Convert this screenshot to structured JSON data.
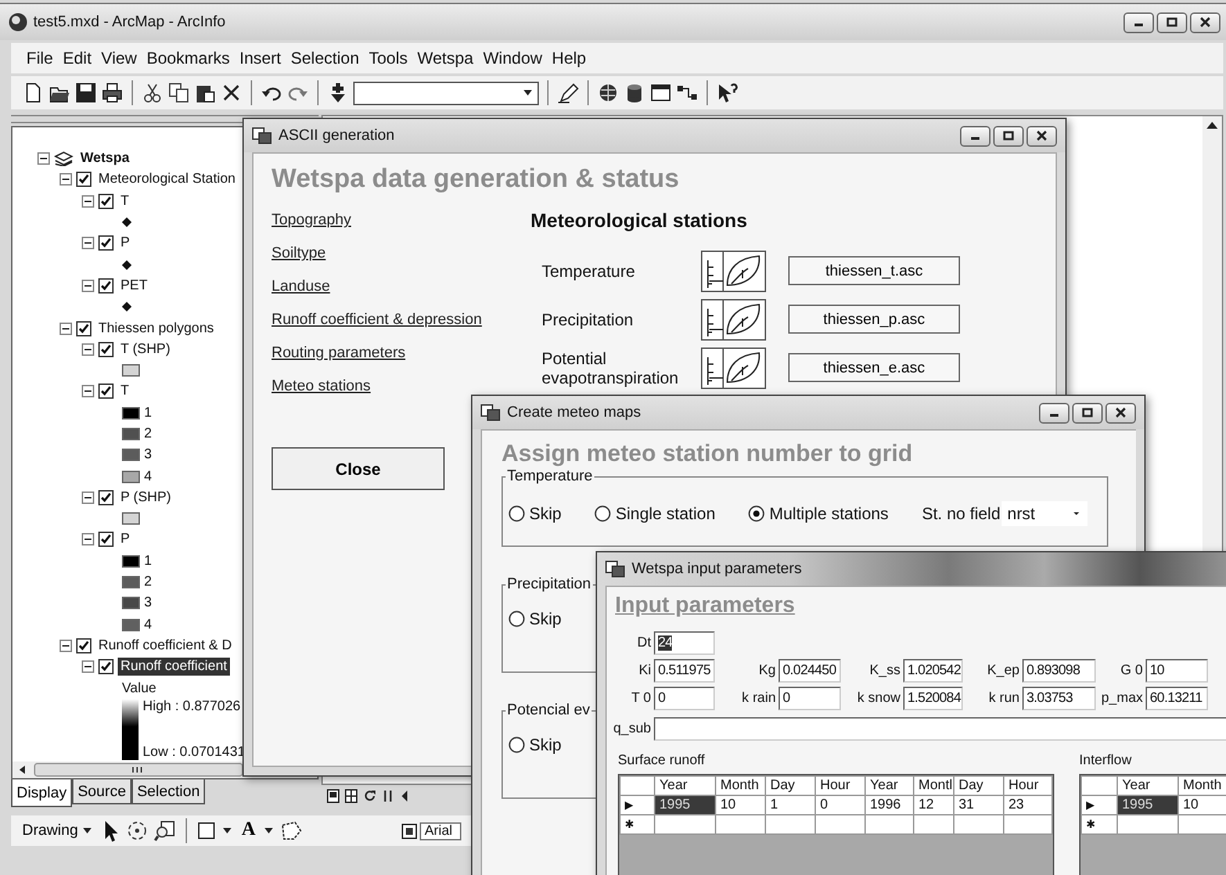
{
  "main_window": {
    "title": "test5.mxd - ArcMap - ArcInfo"
  },
  "menu": [
    "File",
    "Edit",
    "View",
    "Bookmarks",
    "Insert",
    "Selection",
    "Tools",
    "Wetspa",
    "Window",
    "Help"
  ],
  "toc": {
    "tree": [
      {
        "label": "Wetspa",
        "kind": "group",
        "expanded": true,
        "selected": false,
        "children": [
          {
            "label": "Meteorological Station",
            "kind": "layer",
            "checked": true,
            "expanded": true,
            "selected": false,
            "children": [
              {
                "label": "T",
                "kind": "layer",
                "checked": true,
                "expanded": true,
                "selected": false,
                "legend": [
                  {
                    "kind": "marker"
                  }
                ]
              },
              {
                "label": "P",
                "kind": "layer",
                "checked": true,
                "expanded": true,
                "selected": false,
                "legend": [
                  {
                    "kind": "marker"
                  }
                ]
              },
              {
                "label": "PET",
                "kind": "layer",
                "checked": true,
                "expanded": true,
                "selected": false,
                "legend": [
                  {
                    "kind": "marker"
                  }
                ]
              }
            ]
          },
          {
            "label": "Thiessen polygons",
            "kind": "layer",
            "checked": true,
            "expanded": true,
            "selected": false,
            "children": [
              {
                "label": "T (SHP)",
                "kind": "layer",
                "checked": true,
                "expanded": true,
                "selected": false,
                "legend": [
                  {
                    "kind": "swatch",
                    "color": "#d4d4d4"
                  }
                ]
              },
              {
                "label": "T",
                "kind": "layer",
                "checked": true,
                "expanded": true,
                "selected": false,
                "legend": [
                  {
                    "kind": "swatch",
                    "color": "#000000",
                    "label": "1"
                  },
                  {
                    "kind": "swatch",
                    "color": "#505050",
                    "label": "2"
                  },
                  {
                    "kind": "swatch",
                    "color": "#5c5c5c",
                    "label": "3"
                  },
                  {
                    "kind": "swatch",
                    "color": "#a8a8a8",
                    "label": "4"
                  }
                ]
              },
              {
                "label": "P (SHP)",
                "kind": "layer",
                "checked": true,
                "expanded": true,
                "selected": false,
                "legend": [
                  {
                    "kind": "swatch",
                    "color": "#d4d4d4"
                  }
                ]
              },
              {
                "label": "P",
                "kind": "layer",
                "checked": true,
                "expanded": true,
                "selected": false,
                "legend": [
                  {
                    "kind": "swatch",
                    "color": "#000000",
                    "label": "1"
                  },
                  {
                    "kind": "swatch",
                    "color": "#5c5c5c",
                    "label": "2"
                  },
                  {
                    "kind": "swatch",
                    "color": "#484848",
                    "label": "3"
                  },
                  {
                    "kind": "swatch",
                    "color": "#606060",
                    "label": "4"
                  }
                ]
              }
            ]
          },
          {
            "label": "Runoff coefficient & D",
            "kind": "layer",
            "checked": true,
            "expanded": true,
            "selected": false,
            "children": [
              {
                "label": "Runoff coefficient",
                "kind": "layer",
                "checked": true,
                "expanded": true,
                "selected": true,
                "legend": [
                  {
                    "kind": "heading",
                    "label": "Value"
                  },
                  {
                    "kind": "ramp",
                    "high": "High : 0.877026",
                    "low": "Low : 0.0701431"
                  }
                ]
              }
            ]
          }
        ]
      }
    ],
    "tabs": [
      {
        "label": "Display",
        "selected": true
      },
      {
        "label": "Source",
        "selected": false
      },
      {
        "label": "Selection",
        "selected": false
      }
    ]
  },
  "drawing_toolbar": {
    "menu_label": "Drawing",
    "text_tool": "A",
    "font": "Arial"
  },
  "ascii_window": {
    "title": "ASCII generation",
    "heading": "Wetspa data generation & status",
    "links": [
      "Topography",
      "Soiltype",
      "Landuse",
      "Runoff coefficient & depression",
      "Routing parameters",
      "Meteo stations"
    ],
    "section_title": "Meteorological stations",
    "stations": [
      {
        "label": "Temperature",
        "file": "thiessen_t.asc"
      },
      {
        "label": "Precipitation",
        "file": "thiessen_p.asc"
      },
      {
        "label": "Potential evapotranspiration",
        "file": "thiessen_e.asc"
      }
    ],
    "close_button": "Close"
  },
  "meteo_window": {
    "title": "Create meteo maps",
    "heading": "Assign meteo station number to grid",
    "groups": [
      {
        "label": "Temperature",
        "options": [
          {
            "label": "Skip",
            "selected": false
          },
          {
            "label": "Single station",
            "selected": false
          },
          {
            "label": "Multiple stations",
            "selected": true
          }
        ],
        "field_label": "St. no field",
        "field_value": "nrst"
      },
      {
        "label": "Precipitation",
        "options": [
          {
            "label": "Skip",
            "selected": false
          }
        ]
      },
      {
        "label": "Potencial ev",
        "options": [
          {
            "label": "Skip",
            "selected": false
          }
        ]
      }
    ]
  },
  "input_window": {
    "title": "Wetspa input parameters",
    "heading": "Input parameters",
    "field_rows": [
      [
        {
          "label": "Dt",
          "value": "24",
          "selected": true
        }
      ],
      [
        {
          "label": "Ki",
          "value": "0.511975",
          "selected": false
        },
        {
          "label": "Kg",
          "value": "0.024450",
          "selected": false
        },
        {
          "label": "K_ss",
          "value": "1.020542",
          "selected": false
        },
        {
          "label": "K_ep",
          "value": "0.893098",
          "selected": false
        },
        {
          "label": "G 0",
          "value": "10",
          "selected": false
        }
      ],
      [
        {
          "label": "T 0",
          "value": "0",
          "selected": false
        },
        {
          "label": "k rain",
          "value": "0",
          "selected": false
        },
        {
          "label": "k snow",
          "value": "1.520084",
          "selected": false
        },
        {
          "label": "k run",
          "value": "3.03753",
          "selected": false
        },
        {
          "label": "p_max",
          "value": "60.13211",
          "selected": false
        }
      ],
      [
        {
          "label": "q_sub",
          "selected": false
        }
      ]
    ],
    "tables": [
      {
        "label": "Surface runoff",
        "columns": [
          "Year",
          "Month",
          "Day",
          "Hour",
          "Year",
          "Montl",
          "Day",
          "Hour"
        ],
        "rows": [
          {
            "indicator": "▶",
            "cells": [
              {
                "text": "1995",
                "selected": true
              },
              {
                "text": "10",
                "selected": false
              },
              {
                "text": "1",
                "selected": false
              },
              {
                "text": "0",
                "selected": false
              },
              {
                "text": "1996",
                "selected": false
              },
              {
                "text": "12",
                "selected": false
              },
              {
                "text": "31",
                "selected": false
              },
              {
                "text": "23",
                "selected": false
              }
            ]
          },
          {
            "indicator": "✱"
          }
        ]
      },
      {
        "label": "Interflow",
        "columns": [
          "Year",
          "Month"
        ],
        "rows": [
          {
            "indicator": "▶",
            "cells": [
              {
                "text": "1995",
                "selected": true
              },
              {
                "text": "10",
                "selected": false
              }
            ]
          },
          {
            "indicator": "✱"
          }
        ]
      }
    ]
  }
}
